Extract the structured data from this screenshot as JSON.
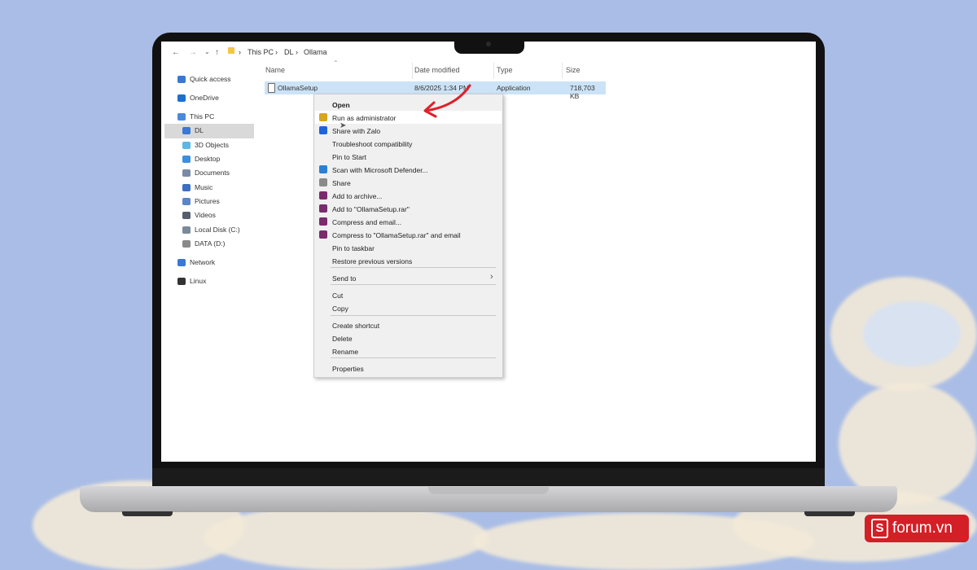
{
  "explorer": {
    "breadcrumb": [
      "This PC",
      "DL",
      "Ollama"
    ],
    "columns": [
      "Name",
      "Date modified",
      "Type",
      "Size"
    ],
    "sidebar": [
      {
        "label": "Quick access",
        "icon": "star-icon",
        "color": "#3a78d6"
      },
      {
        "label": "OneDrive",
        "icon": "cloud-icon",
        "color": "#1c6fd1"
      },
      {
        "label": "This PC",
        "icon": "computer-icon",
        "color": "#4a89dc"
      },
      {
        "label": "DL",
        "icon": "download-folder-icon",
        "color": "#3a78d6"
      },
      {
        "label": "3D Objects",
        "icon": "cube-icon",
        "color": "#5bb7e8"
      },
      {
        "label": "Desktop",
        "icon": "desktop-icon",
        "color": "#3b8ee0"
      },
      {
        "label": "Documents",
        "icon": "document-icon",
        "color": "#7a8aa6"
      },
      {
        "label": "Music",
        "icon": "music-icon",
        "color": "#3a6fc4"
      },
      {
        "label": "Pictures",
        "icon": "pictures-icon",
        "color": "#5a86c8"
      },
      {
        "label": "Videos",
        "icon": "video-icon",
        "color": "#555f70"
      },
      {
        "label": "Local Disk (C:)",
        "icon": "disk-icon",
        "color": "#7a8a9a"
      },
      {
        "label": "DATA (D:)",
        "icon": "drive-icon",
        "color": "#8a8a8a"
      },
      {
        "label": "Network",
        "icon": "network-icon",
        "color": "#3a78d6"
      },
      {
        "label": "Linux",
        "icon": "linux-icon",
        "color": "#333333"
      }
    ],
    "file": {
      "name": "OllamaSetup",
      "date": "8/6/2025 1:34 PM",
      "type": "Application",
      "size": "718,703 KB"
    }
  },
  "context_menu": {
    "items": [
      {
        "label": "Open",
        "icon": ""
      },
      {
        "label": "Run as administrator",
        "icon": "shield-icon"
      },
      {
        "label": "Share with Zalo",
        "icon": "zalo-icon"
      },
      {
        "label": "Troubleshoot compatibility",
        "icon": ""
      },
      {
        "label": "Pin to Start",
        "icon": ""
      },
      {
        "label": "Scan with Microsoft Defender...",
        "icon": "defender-icon"
      },
      {
        "label": "Share",
        "icon": "share-icon"
      },
      {
        "label": "Add to archive...",
        "icon": "winrar-icon"
      },
      {
        "label": "Add to \"OllamaSetup.rar\"",
        "icon": "winrar-icon"
      },
      {
        "label": "Compress and email...",
        "icon": "winrar-icon"
      },
      {
        "label": "Compress to \"OllamaSetup.rar\" and email",
        "icon": "winrar-icon"
      },
      {
        "label": "Pin to taskbar",
        "icon": ""
      },
      {
        "label": "Restore previous versions",
        "icon": ""
      },
      {
        "label": "Send to",
        "icon": ""
      },
      {
        "label": "Cut",
        "icon": ""
      },
      {
        "label": "Copy",
        "icon": ""
      },
      {
        "label": "Create shortcut",
        "icon": ""
      },
      {
        "label": "Delete",
        "icon": ""
      },
      {
        "label": "Rename",
        "icon": ""
      },
      {
        "label": "Properties",
        "icon": ""
      }
    ]
  },
  "annotation": {
    "arrow_color": "#e0202a"
  },
  "watermark": {
    "letter": "S",
    "text": "forum.vn",
    "color": "#d31f26"
  }
}
